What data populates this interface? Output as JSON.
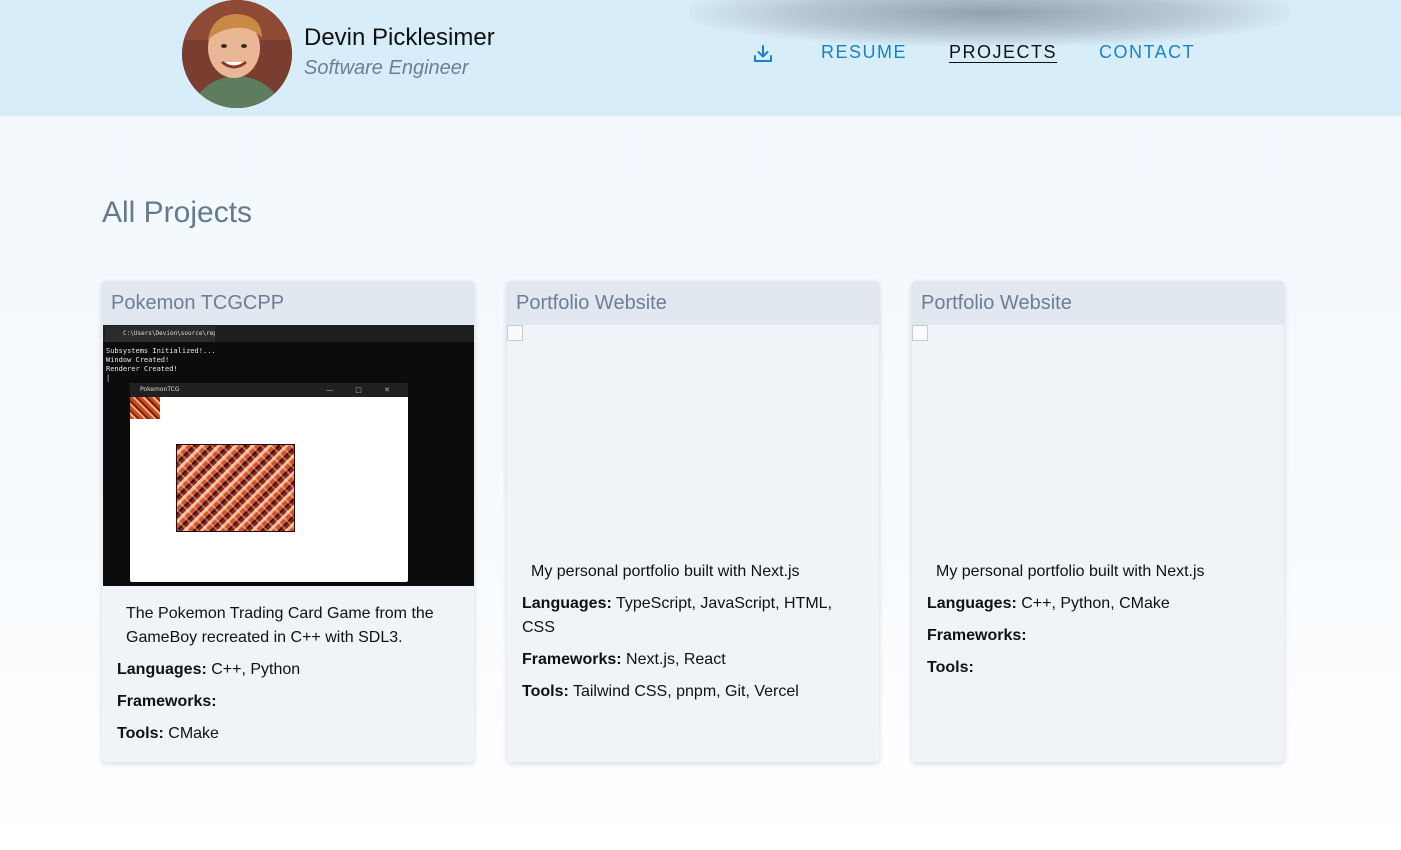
{
  "header": {
    "name": "Devin Picklesimer",
    "role": "Software Engineer",
    "download_icon": "download-icon",
    "nav": [
      {
        "label": "RESUME",
        "active": false
      },
      {
        "label": "PROJECTS",
        "active": true
      },
      {
        "label": "CONTACT",
        "active": false
      }
    ]
  },
  "main": {
    "title": "All Projects",
    "projects": [
      {
        "title": "Pokemon TCGCPP",
        "image": {
          "tab_label": "C:\\Users\\Devion\\source\\repos",
          "terminal_lines": "Subsystems Initialized!...\nWindow Created!\nRenderer Created!\n|",
          "window_title": "PokemonTCG",
          "window_controls": "— □ ✕"
        },
        "description": "The Pokemon Trading Card Game from the GameBoy recreated in C++ with SDL3.",
        "languages_label": "Languages:",
        "languages": "C++, Python",
        "frameworks_label": "Frameworks:",
        "frameworks": "",
        "tools_label": "Tools:",
        "tools": "CMake"
      },
      {
        "title": "Portfolio Website",
        "description": "My personal portfolio built with Next.js",
        "languages_label": "Languages:",
        "languages": "TypeScript, JavaScript, HTML, CSS",
        "frameworks_label": "Frameworks:",
        "frameworks": "Next.js, React",
        "tools_label": "Tools:",
        "tools": "Tailwind CSS, pnpm, Git, Vercel"
      },
      {
        "title": "Portfolio Website",
        "description": "My personal portfolio built with Next.js",
        "languages_label": "Languages:",
        "languages": "C++, Python, CMake",
        "frameworks_label": "Frameworks:",
        "frameworks": "",
        "tools_label": "Tools:",
        "tools": ""
      }
    ]
  },
  "colors": {
    "header_bg": "#d8edfa",
    "nav_link": "#1a82c4",
    "muted_text": "#637a90",
    "card_bg": "#f0f3f7",
    "card_header_bg": "#e2e8ef"
  }
}
